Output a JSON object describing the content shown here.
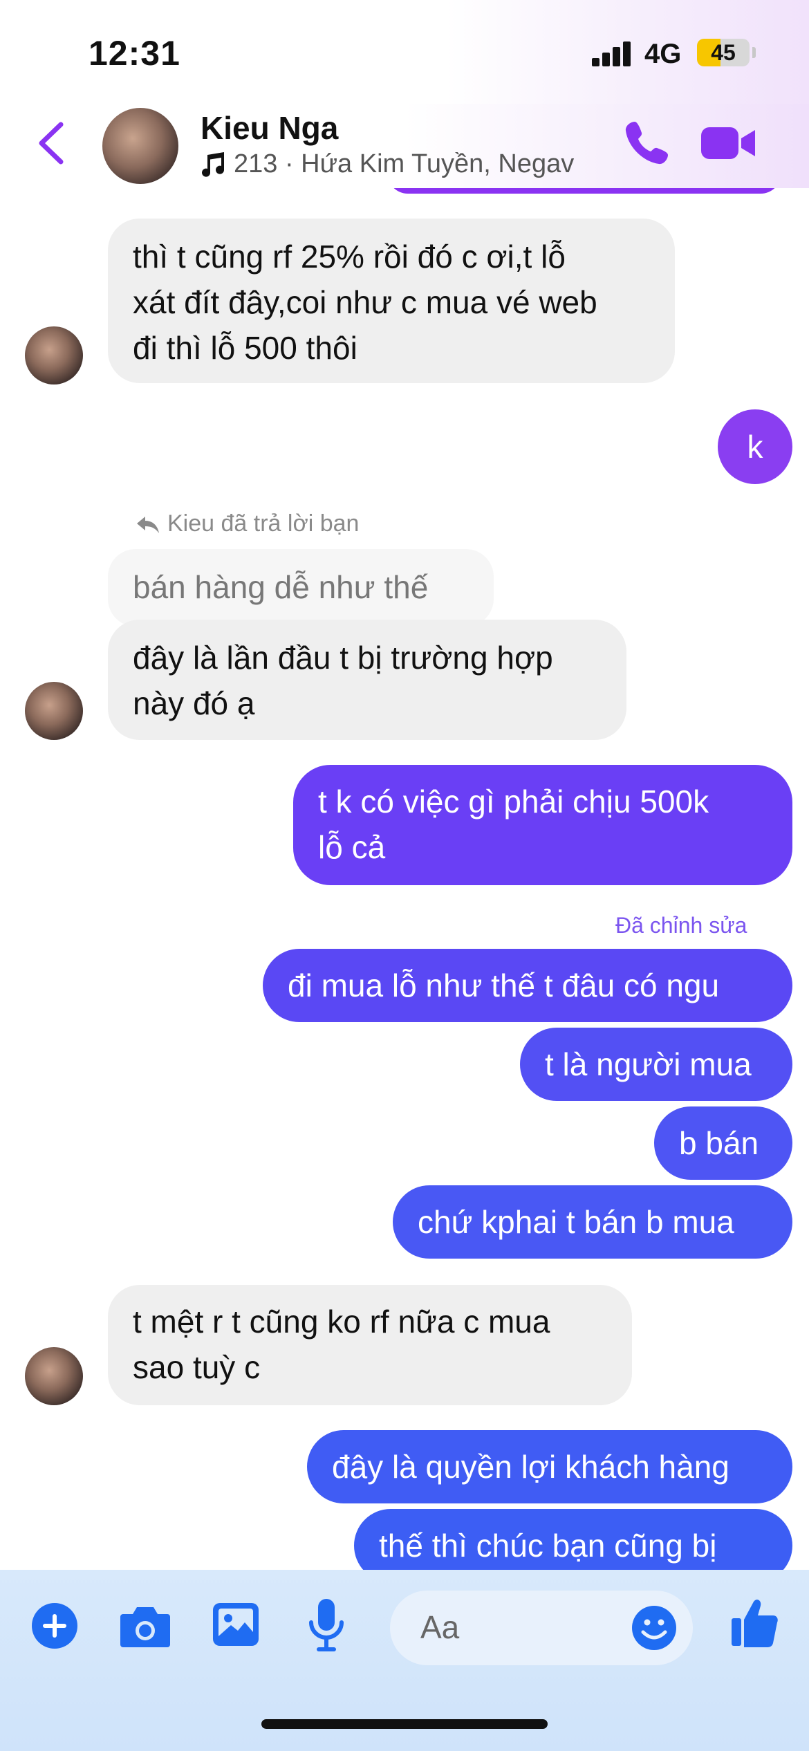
{
  "status_bar": {
    "time": "12:31",
    "network": "4G",
    "battery": "45",
    "battery_level": 0.45
  },
  "header": {
    "name": "Kieu Nga",
    "subtitle": "213 · Hứa Kim Tuyền, Negav",
    "icons": [
      "back-chevron-icon",
      "avatar",
      "music-note-icon",
      "phone-icon",
      "video-camera-icon"
    ]
  },
  "colors": {
    "accent": "#8a33f2",
    "outgoing_top": "#6a3ff5",
    "outgoing_bottom": "#3f5cf4",
    "incoming": "#efefef"
  },
  "messages": [
    {
      "from": "them",
      "lines": [
        "thì t cũng rf 25% rồi đó c ơi,t lỗ",
        "xát đít đây,coi như c mua vé web",
        "đi thì lỗ 500 thôi"
      ]
    },
    {
      "from": "me",
      "lines": [
        "k"
      ]
    },
    {
      "reply_label": "Kieu đã trả lời bạn",
      "quoted": "bán hàng dễ như thế cơ"
    },
    {
      "from": "them",
      "lines": [
        "đây là lần đầu t bị trường hợp",
        "này đó ạ"
      ]
    },
    {
      "from": "me",
      "lines": [
        "t k có việc gì phải chịu 500k",
        "lỗ cả"
      ]
    },
    {
      "edited_label": "Đã chỉnh sửa"
    },
    {
      "from": "me",
      "lines": [
        "đi mua lỗ như thế t đâu có ngu"
      ]
    },
    {
      "from": "me",
      "lines": [
        "t là người mua"
      ]
    },
    {
      "from": "me",
      "lines": [
        "b bán"
      ]
    },
    {
      "from": "me",
      "lines": [
        "chứ kphai t bán b mua"
      ]
    },
    {
      "from": "them",
      "lines": [
        "t mệt r t cũng ko rf nữa c mua",
        "sao tuỳ c"
      ]
    },
    {
      "from": "me",
      "lines": [
        "đây là quyền lợi khách hàng"
      ]
    },
    {
      "from": "me",
      "lines": [
        "thế thì chúc bạn cũng bị"
      ]
    }
  ],
  "composer": {
    "placeholder": "Aa",
    "icons": [
      "plus-icon",
      "camera-icon",
      "gallery-icon",
      "microphone-icon",
      "emoji-icon",
      "thumbs-up-icon"
    ]
  }
}
